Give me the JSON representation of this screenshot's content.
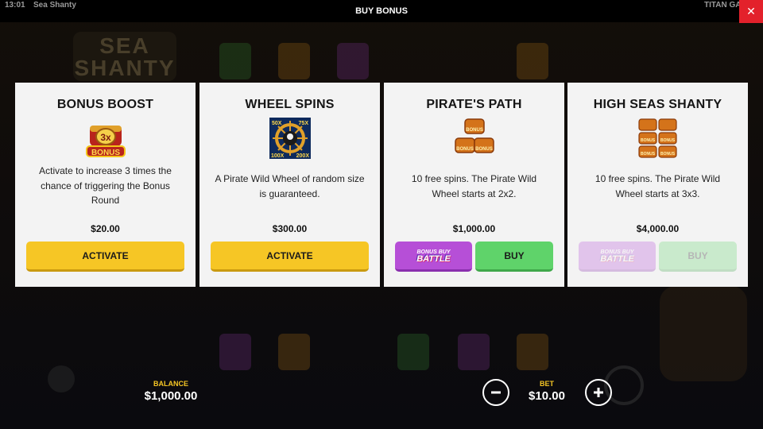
{
  "topbar": {
    "time": "13:01",
    "game_title": "Sea Shanty",
    "screen_title": "BUY BONUS",
    "provider": "TITAN GA",
    "close_icon": "close-icon"
  },
  "background": {
    "logo_text": "SEA SHANTY"
  },
  "cards": [
    {
      "title": "BONUS BOOST",
      "icon": "bonus-chest-3x-icon",
      "description": "Activate to increase 3 times the chance of triggering the Bonus Round",
      "price": "$20.00",
      "button_label": "ACTIVATE"
    },
    {
      "title": "WHEEL SPINS",
      "icon": "pirate-wheel-icon",
      "description": "A Pirate Wild Wheel of random size is guaranteed.",
      "price": "$300.00",
      "button_label": "ACTIVATE"
    },
    {
      "title": "PIRATE'S PATH",
      "icon": "bonus-chests-2x2-icon",
      "description": "10 free spins. The Pirate Wild Wheel starts at 2x2.",
      "price": "$1,000.00",
      "battle_label_small": "BONUS BUY",
      "battle_label_big": "BATTLE",
      "button_label": "BUY",
      "enabled": true
    },
    {
      "title": "HIGH SEAS SHANTY",
      "icon": "bonus-chests-3x3-icon",
      "description": "10 free spins. The Pirate Wild Wheel starts at 3x3.",
      "price": "$4,000.00",
      "battle_label_small": "BONUS BUY",
      "battle_label_big": "BATTLE",
      "button_label": "BUY",
      "enabled": false
    }
  ],
  "icon_text": {
    "boost_multiplier": "3x",
    "boost_bonus": "BONUS",
    "wheel_tl": "50X",
    "wheel_tr": "75X",
    "wheel_bl": "100X",
    "wheel_br": "200X",
    "chest_bonus": "BONUS"
  },
  "footer": {
    "balance_label": "BALANCE",
    "balance_value": "$1,000.00",
    "bet_label": "BET",
    "bet_value": "$10.00",
    "minus_icon": "minus-icon",
    "plus_icon": "plus-icon"
  },
  "colors": {
    "activate_button": "#f6c625",
    "buy_button": "#5fd36a",
    "battle_button": "#b64fd7",
    "close_button": "#e3212b",
    "label_accent": "#f6c625"
  }
}
